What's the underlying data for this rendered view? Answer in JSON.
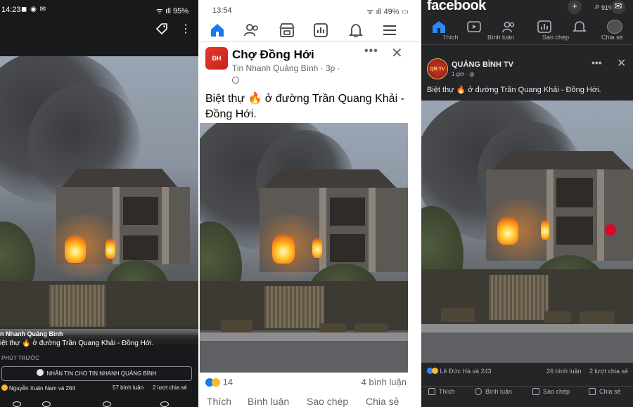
{
  "left_panel": {
    "status": {
      "time": "14:23",
      "battery": "95%"
    },
    "page_name": "n Nhanh Quảng Bình",
    "caption": "iệt thự 🔥 ở đường Trần Quang Khải - Đồng Hới.",
    "time_ago": "PHÚT TRƯỚC",
    "message_button": "NHẮN TIN CHO TIN NHANH QUẢNG BÌNH",
    "reactions_text": "Nguyễn Xuân Nam và 264",
    "comments": "57 bình luận",
    "shares": "2 lượt chia sẻ"
  },
  "middle_panel": {
    "status": {
      "time": "13:54",
      "battery": "49%"
    },
    "group_name": "Chợ Đồng Hới",
    "subtitle": "Tin Nhanh Quảng Bình · 3p ·",
    "post_text": "Biệt thự 🔥 ở đường Trần Quang Khải - Đồng Hới.",
    "reaction_count": "14",
    "comments": "4 bình luận",
    "actions": {
      "like": "Thích",
      "comment": "Bình luận",
      "copy": "Sao chép",
      "share": "Chia sẻ"
    }
  },
  "right_panel": {
    "logo": "facebook",
    "status": {
      "battery": "91%"
    },
    "cut_actions": {
      "like": "Thích",
      "comment": "Bình luận",
      "copy": "Sao chép",
      "share": "Chia sẻ"
    },
    "page_name": "QUẢNG BÌNH TV",
    "time_ago": "1 giờ ·",
    "post_text": "Biệt thự 🔥 ở đường Trần Quang Khải - Đồng Hới.",
    "reactions_text": "Lê Đức Hà và 243",
    "comments": "26 bình luận",
    "shares": "2 lượt chia sẻ",
    "actions": {
      "like": "Thích",
      "comment": "Bình luận",
      "copy": "Sao chép",
      "share": "Chia sẻ"
    }
  },
  "colors": {
    "facebook_blue": "#1877f2",
    "dark_bg": "#18191a",
    "dark_card": "#242526",
    "record_red": "#e4002b"
  }
}
